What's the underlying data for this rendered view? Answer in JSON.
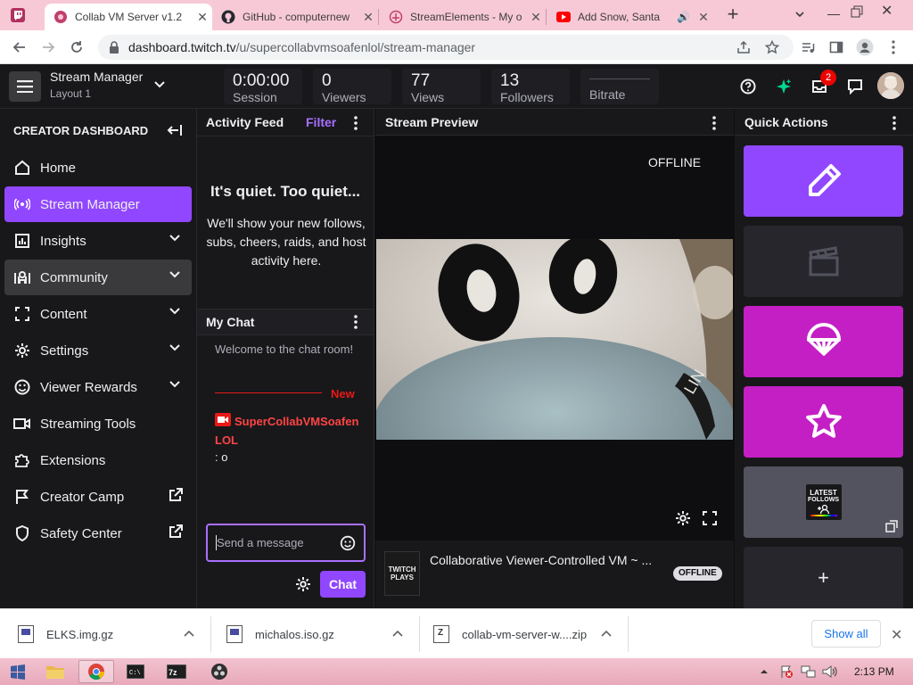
{
  "browser": {
    "tabs": [
      {
        "title": "Collab VM Server v1.2",
        "icon": "collabvm-icon"
      },
      {
        "title": "GitHub - computernew",
        "icon": "github-icon"
      },
      {
        "title": "StreamElements - My o",
        "icon": "streamelements-icon"
      },
      {
        "title": "Add Snow, Santa",
        "icon": "youtube-icon"
      }
    ],
    "url_host": "dashboard.twitch.tv",
    "url_path": "/u/supercollabvmsoafenlol/stream-manager"
  },
  "topbar": {
    "title": "Stream Manager",
    "subtitle": "Layout 1",
    "stats": [
      {
        "value": "0:00:00",
        "label": "Session"
      },
      {
        "value": "0",
        "label": "Viewers"
      },
      {
        "value": "77",
        "label": "Views"
      },
      {
        "value": "13",
        "label": "Followers"
      },
      {
        "value": "",
        "label": "Bitrate"
      }
    ],
    "inbox_badge": "2"
  },
  "sidebar": {
    "heading": "CREATOR DASHBOARD",
    "items": [
      {
        "label": "Home"
      },
      {
        "label": "Stream Manager"
      },
      {
        "label": "Insights"
      },
      {
        "label": "Community"
      },
      {
        "label": "Content"
      },
      {
        "label": "Settings"
      },
      {
        "label": "Viewer Rewards"
      },
      {
        "label": "Streaming Tools"
      },
      {
        "label": "Extensions"
      },
      {
        "label": "Creator Camp"
      },
      {
        "label": "Safety Center"
      }
    ]
  },
  "activity": {
    "title": "Activity Feed",
    "filter": "Filter",
    "empty_title": "It's quiet. Too quiet...",
    "empty_body": "We'll show your new follows, subs, cheers, raids, and host activity here."
  },
  "chat": {
    "title": "My Chat",
    "welcome": "Welcome to the chat room!",
    "new_label": "New",
    "username": "SuperCollabVMSoafenLOL",
    "message": ": o",
    "placeholder": "Send a message",
    "send_label": "Chat"
  },
  "preview": {
    "title": "Stream Preview",
    "status": "OFFLINE",
    "stream_title": "Collaborative Viewer-Controlled VM ~ ...",
    "badge": "OFFLINE",
    "thumb_text": "TWITCH PLAYS"
  },
  "quick": {
    "title": "Quick Actions",
    "tile_text_1": "LATEST",
    "tile_text_2": "FOLLOWS",
    "colors": {
      "edit": "#9147ff",
      "clip": "#26262c",
      "ad": "#c41fc4",
      "promote": "#c41fc4"
    }
  },
  "downloads": {
    "items": [
      {
        "name": "ELKS.img.gz"
      },
      {
        "name": "michalos.iso.gz"
      },
      {
        "name": "collab-vm-server-w....zip"
      }
    ],
    "show_all": "Show all"
  },
  "taskbar": {
    "clock": "2:13 PM"
  }
}
